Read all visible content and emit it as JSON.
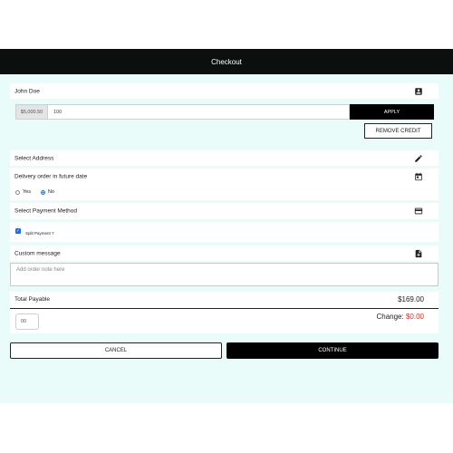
{
  "header": {
    "title": "Checkout"
  },
  "customer": {
    "name": "John Doe"
  },
  "credit": {
    "available": "$5,000.50",
    "input_value": "100",
    "apply_label": "APPLY",
    "remove_label": "REMOVE CREDIT"
  },
  "address": {
    "label": "Select Address"
  },
  "delivery": {
    "label": "Delivery order in future date",
    "options": [
      "Yes",
      "No"
    ],
    "selected": "No"
  },
  "payment": {
    "label": "Select Payment Method",
    "split_label": "Split Payment ?",
    "split_checked": true
  },
  "message": {
    "label": "Custom message",
    "placeholder": "Add order note here"
  },
  "totals": {
    "payable_label": "Total Payable",
    "payable_value": "$169.00",
    "tendered_value": "00",
    "change_label": "Change:",
    "change_value": "$0.00"
  },
  "actions": {
    "cancel_label": "CANCEL",
    "continue_label": "CONTINUE"
  },
  "colors": {
    "accent": "#1a6ee8",
    "header_bg": "#0b0f0e",
    "panel_bg": "#eafcf9",
    "change_red": "#e0302a"
  },
  "icons": {
    "customer": "account-box-icon",
    "address": "pencil-icon",
    "delivery": "calendar-icon",
    "payment": "credit-card-icon",
    "message": "note-add-icon"
  }
}
